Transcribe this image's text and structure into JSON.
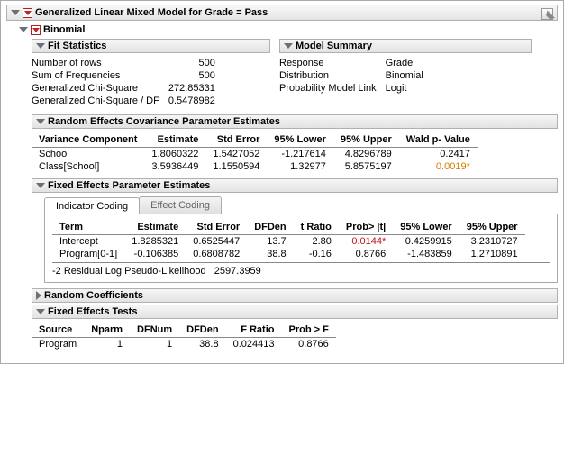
{
  "top_title": "Generalized Linear Mixed Model for Grade = Pass",
  "binomial_title": "Binomial",
  "fit_stats": {
    "title": "Fit Statistics",
    "rows": [
      {
        "label": "Number of rows",
        "value": "500"
      },
      {
        "label": "Sum of Frequencies",
        "value": "500"
      },
      {
        "label": "Generalized Chi-Square",
        "value": "272.85331"
      },
      {
        "label": "Generalized Chi-Square / DF",
        "value": "0.5478982"
      }
    ]
  },
  "model_summary": {
    "title": "Model Summary",
    "rows": [
      {
        "label": "Response",
        "value": "Grade"
      },
      {
        "label": "Distribution",
        "value": "Binomial"
      },
      {
        "label": "Probability Model Link",
        "value": "Logit"
      }
    ]
  },
  "random_cov": {
    "title": "Random Effects Covariance Parameter Estimates",
    "headers": {
      "vc": "Variance\nComponent",
      "est": "Estimate",
      "se": "Std Error",
      "lo": "95% Lower",
      "hi": "95% Upper",
      "wp": "Wald p-\nValue"
    },
    "rows": [
      {
        "vc": "School",
        "est": "1.8060322",
        "se": "1.5427052",
        "lo": "-1.217614",
        "hi": "4.8296789",
        "wp": "0.2417",
        "sig": false
      },
      {
        "vc": "Class[School]",
        "est": "3.5936449",
        "se": "1.1550594",
        "lo": "1.32977",
        "hi": "5.8575197",
        "wp": "0.0019*",
        "sig": true
      }
    ]
  },
  "fixed_est": {
    "title": "Fixed Effects Parameter Estimates",
    "tabs": {
      "indicator": "Indicator Coding",
      "effect": "Effect Coding"
    },
    "headers": {
      "term": "Term",
      "est": "Estimate",
      "se": "Std Error",
      "dfden": "DFDen",
      "t": "t Ratio",
      "p": "Prob> |t|",
      "lo": "95% Lower",
      "hi": "95% Upper"
    },
    "rows": [
      {
        "term": "Intercept",
        "est": "1.8285321",
        "se": "0.6525447",
        "dfden": "13.7",
        "t": "2.80",
        "p": "0.0144*",
        "psig": true,
        "lo": "0.4259915",
        "hi": "3.2310727"
      },
      {
        "term": "Program[0-1]",
        "est": "-0.106385",
        "se": "0.6808782",
        "dfden": "38.8",
        "t": "-0.16",
        "p": "0.8766",
        "psig": false,
        "lo": "-1.483859",
        "hi": "1.2710891"
      }
    ],
    "pl_label": "-2 Residual Log Pseudo-Likelihood",
    "pl_value": "2597.3959"
  },
  "random_coef_title": "Random Coefficients",
  "fixed_tests": {
    "title": "Fixed Effects Tests",
    "headers": {
      "src": "Source",
      "np": "Nparm",
      "dfn": "DFNum",
      "dfd": "DFDen",
      "f": "F Ratio",
      "p": "Prob > F"
    },
    "rows": [
      {
        "src": "Program",
        "np": "1",
        "dfn": "1",
        "dfd": "38.8",
        "f": "0.024413",
        "p": "0.8766"
      }
    ]
  }
}
